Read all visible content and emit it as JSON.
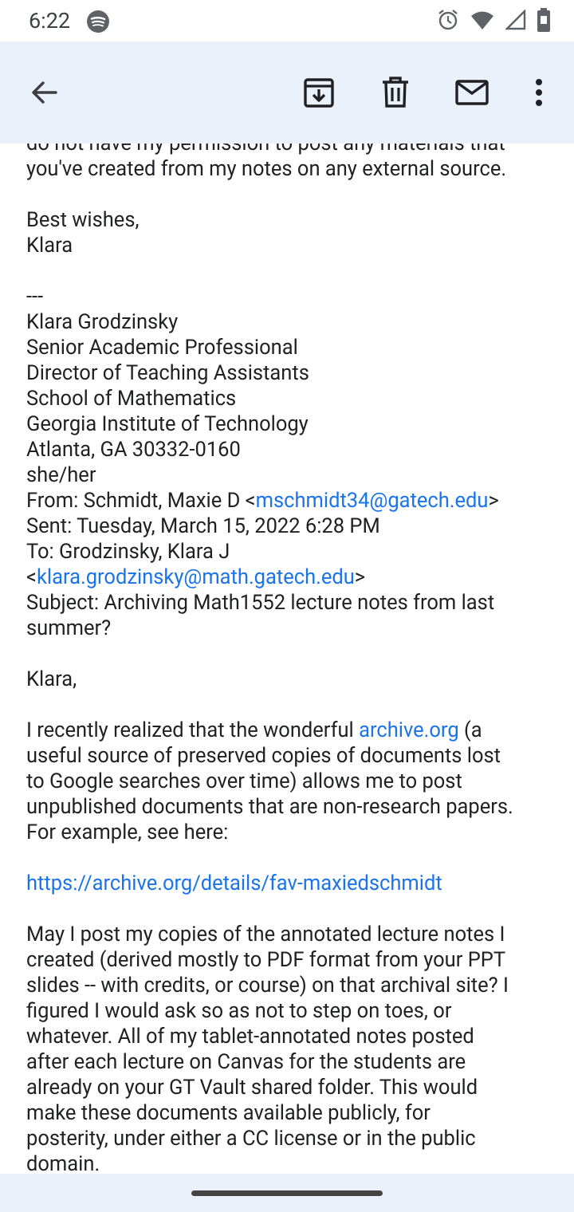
{
  "status": {
    "time": "6:22"
  },
  "icons": {
    "spotify": "spotify-icon",
    "alarm": "alarm-icon",
    "wifi": "wifi-icon",
    "signal": "signal-icon",
    "battery": "battery-icon",
    "back": "arrow-back-icon",
    "archive": "archive-icon",
    "delete": "trash-icon",
    "mail": "mail-icon",
    "more": "more-vert-icon"
  },
  "colors": {
    "toolbar": "#eaf1fb",
    "link": "#1a73e8"
  },
  "email": {
    "cut_line": "do not have my permission to post any materials that",
    "line1": "you've created from my notes on any external source.",
    "closing": "Best wishes,",
    "closing_name": "Klara",
    "sig_sep": "---",
    "sig": [
      "Klara Grodzinsky",
      "Senior Academic Professional",
      "Director of Teaching Assistants",
      "School of Mathematics",
      "Georgia Institute of Technology",
      "Atlanta, GA 30332-0160",
      "she/her"
    ],
    "from_prefix": "From: Schmidt, Maxie D <",
    "from_email": "mschmidt34@gatech.edu",
    "from_suffix": ">",
    "sent": "Sent: Tuesday, March 15, 2022 6:28 PM",
    "to_line": "To: Grodzinsky, Klara J",
    "to_prefix": "<",
    "to_email": "klara.grodzinsky@math.gatech.edu",
    "to_suffix": ">",
    "subject_1": "Subject: Archiving Math1552 lecture notes from last",
    "subject_2": "summer?",
    "greeting": "Klara,",
    "p1_a": "I recently realized that the wonderful ",
    "p1_link": "archive.org",
    "p1_b": " (a",
    "p1_lines": [
      "useful source of preserved copies of documents lost",
      "to Google searches over time) allows me to post",
      "unpublished documents that are non-research papers.",
      "For example, see here:"
    ],
    "url": "https://archive.org/details/fav-maxiedschmidt",
    "p2_lines": [
      "May I post my copies of the annotated lecture notes I",
      "created (derived mostly to PDF format from your PPT",
      "slides -- with credits, or course) on that archival site? I",
      "figured I would ask so as not to step on toes, or",
      "whatever. All of my tablet-annotated notes posted",
      "after each lecture on Canvas for the students are",
      "already on your GT Vault shared folder. This would",
      "make these documents available publicly, for",
      "posterity, under either a CC license or in the public",
      "domain."
    ]
  }
}
